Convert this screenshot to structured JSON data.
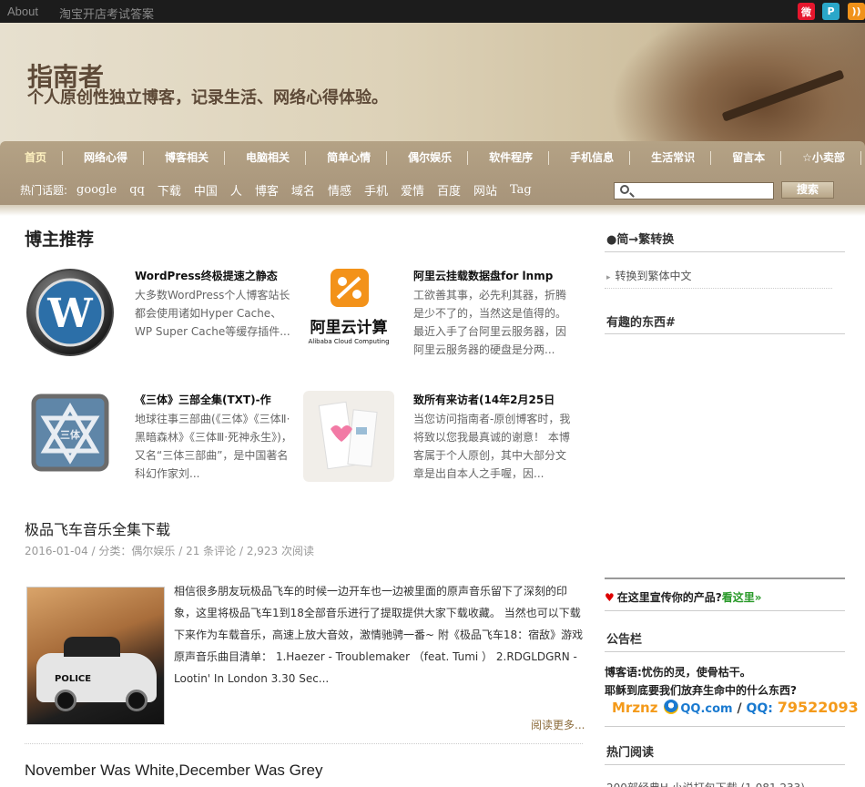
{
  "topbar": {
    "links": [
      "About",
      "淘宝开店考试答案"
    ],
    "social_icons": [
      "weibo-icon",
      "tencent-weibo-icon",
      "rss-icon"
    ]
  },
  "header": {
    "site_title": "指南者",
    "site_description": "个人原创性独立博客，记录生活、网络心得体验。"
  },
  "nav": {
    "menu": [
      "首页",
      "网络心得",
      "博客相关",
      "电脑相关",
      "简单心情",
      "偶尔娱乐",
      "软件程序",
      "手机信息",
      "生活常识",
      "留言本",
      "☆小卖部"
    ],
    "hot_label": "热门话题:",
    "hot_tags": [
      "google",
      "qq",
      "下载",
      "中国",
      "人",
      "博客",
      "域名",
      "情感",
      "手机",
      "爱情",
      "百度",
      "网站",
      "Tag"
    ],
    "search_placeholder": "",
    "search_button": "搜索"
  },
  "main": {
    "section_title": "博主推荐",
    "featured": [
      {
        "title": "WordPress终极提速之静态",
        "excerpt": "大多数WordPress个人博客站长都会使用诸如Hyper Cache、WP Super Cache等缓存插件...",
        "thumb": "wordpress-logo"
      },
      {
        "title": "阿里云挂载数据盘for lnmp",
        "excerpt": "工欲善其事，必先利其器，折腾是少不了的，当然这是值得的。最近入手了台阿里云服务器，因阿里云服务器的硬盘是分两...",
        "thumb": "aliyun-logo",
        "logo_cn": "阿里云计算",
        "logo_en": "Alibaba Cloud Computing"
      },
      {
        "title": "《三体》三部全集(TXT)-作",
        "excerpt": "地球往事三部曲(《三体》《三体Ⅱ·黑暗森林》《三体Ⅲ·死神永生》)，又名“三体三部曲”，是中国著名科幻作家刘...",
        "thumb": "santi-logo"
      },
      {
        "title": "致所有来访者(14年2月25日",
        "excerpt": "当您访问指南者-原创博客时，我将致以您我最真诚的谢意！ 本博客属于个人原创，其中大部分文章是出自本人之手喔，因...",
        "thumb": "letter-image"
      }
    ],
    "posts": [
      {
        "title": "极品飞车音乐全集下载",
        "meta": "2016-01-04 / 分类：偶尔娱乐 / 21 条评论 / 2,923 次阅读",
        "excerpt": "相信很多朋友玩极品飞车的时候一边开车也一边被里面的原声音乐留下了深刻的印象，这里将极品飞车1到18全部音乐进行了提取提供大家下载收藏。 当然也可以下载下来作为车载音乐，高速上放大音效，激情驰骋一番~ 附《极品飞车18：宿敌》游戏原声音乐曲目清单： 1.Haezer - Troublemaker （feat. Tumi ） 2.RDGLDGRN - Lootin' In London 3.30 Sec...",
        "image_text": "POLICE",
        "read_more": "阅读更多..."
      },
      {
        "title": "November Was White,December Was Grey"
      }
    ]
  },
  "sidebar": {
    "convert_title": "●简→繁转换",
    "convert_link": "转换到繁体中文",
    "fun_title": "有趣的东西#",
    "ad_text": "在这里宣传你的产品?",
    "ad_link": "看这里»",
    "notice_title": "公告栏",
    "motto_line1": "博客语:忧伤的灵，使骨枯干。",
    "motto_line2": "耶稣到底要我们放弃生命中的什么东西?",
    "qq_brand": "Mrznz",
    "qq_domain": "QQ.com",
    "qq_label": "QQ:",
    "qq_number": "79522093",
    "hot_read_title": "热门阅读",
    "hot_read_first": "200部经典H 小说打包下载 (1,081,233)"
  },
  "colors": {
    "nav_bg": "#a7947a",
    "header_text": "#5e4a38",
    "link_green": "#2a9a2a",
    "qq_orange": "#f49a1a"
  }
}
